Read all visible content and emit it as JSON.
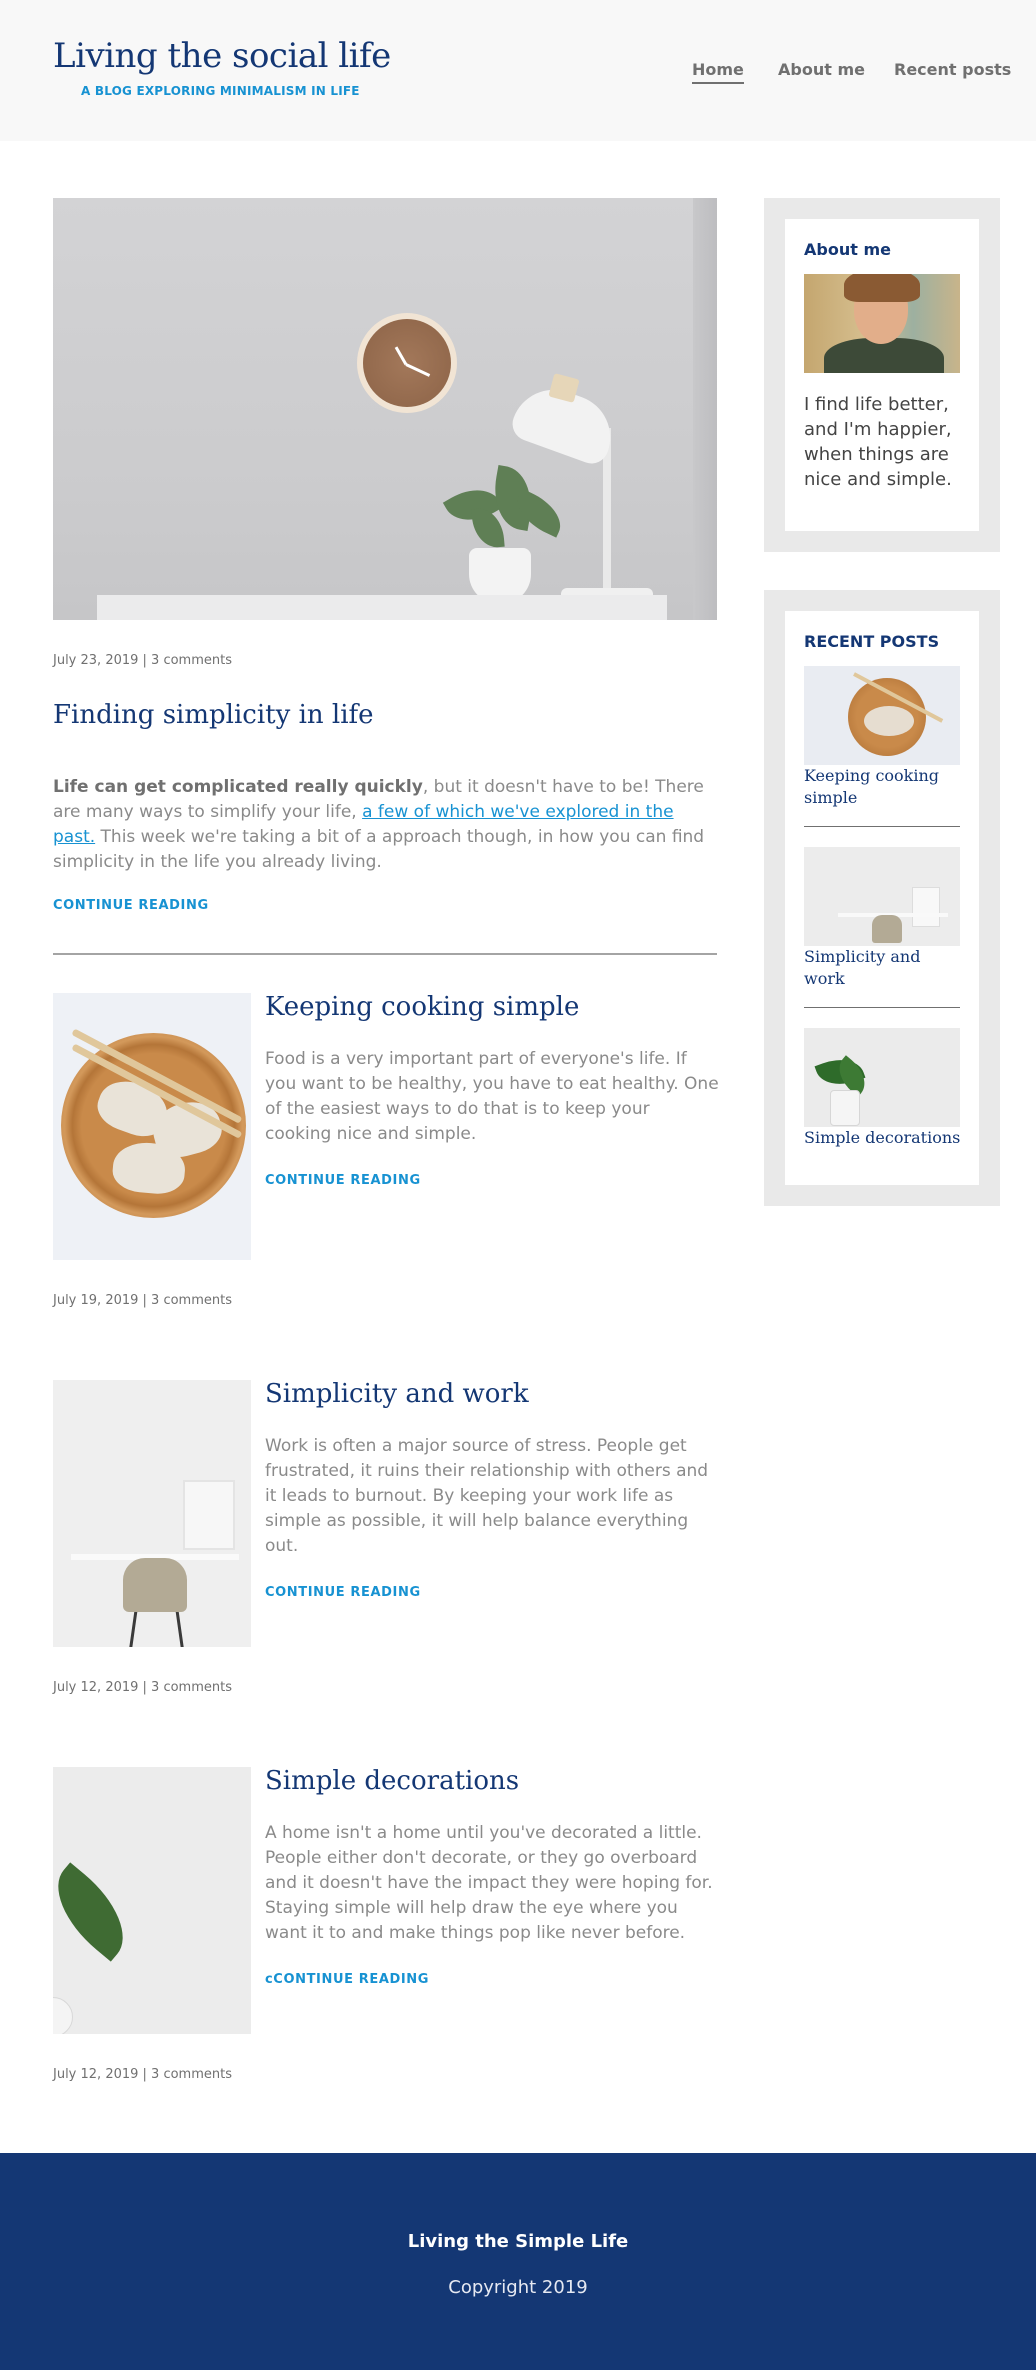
{
  "site": {
    "title": "Living the social life",
    "subtitle": "A BLOG EXPLORING MINIMALISM IN LIFE"
  },
  "nav": [
    {
      "label": "Home",
      "active": true
    },
    {
      "label": "About me",
      "active": false
    },
    {
      "label": "Recent posts",
      "active": false
    }
  ],
  "featured": {
    "meta": "July 23, 2019 | 3 comments",
    "title": "Finding simplicity in life",
    "excerpt_bold": "Life can get complicated really quickly",
    "excerpt_part1": ", but it doesn't have to be! There are many ways to simplify your life, ",
    "excerpt_link": "a few of which we've explored in the past.",
    "excerpt_part2": " This week we're taking a bit of a approach though, in how you can find simplicity in the life you already living.",
    "continue": "CONTINUE READING"
  },
  "posts": [
    {
      "title": "Keeping cooking simple",
      "excerpt": "Food is a very important part of everyone's life. If you want to be healthy, you have to eat healthy. One of the easiest ways to do that is to keep your cooking nice and simple.",
      "continue": "CONTINUE READING",
      "meta": "July 19, 2019 | 3 comments"
    },
    {
      "title": "Simplicity and work",
      "excerpt": "Work is often a major source of stress. People get frustrated, it ruins their relationship with others and it leads to burnout. By keeping your work life as simple as possible, it will help balance everything out.",
      "continue": "CONTINUE READING",
      "meta": "July 12, 2019 | 3 comments"
    },
    {
      "title": "Simple decorations",
      "excerpt": "A home isn't a home until you've decorated a little. People either don't decorate, or they go overboard and it doesn't have the impact they were hoping for. Staying simple will help draw the eye where you want it to and make things pop like never before.",
      "continue": "cCONTINUE READING",
      "meta": "July 12, 2019 | 3 comments"
    }
  ],
  "sidebar": {
    "about": {
      "heading": "About me",
      "text": "I find life better, and I'm happier, when things are nice and simple."
    },
    "recent": {
      "heading": "RECENT POSTS",
      "items": [
        {
          "title": "Keeping cooking simple"
        },
        {
          "title": "Simplicity and work"
        },
        {
          "title": "Simple decorations"
        }
      ]
    }
  },
  "footer": {
    "title": "Living the Simple Life",
    "copyright": "Copyright 2019"
  },
  "colors": {
    "brand": "#143774",
    "accent": "#1792d2",
    "text": "#707070"
  }
}
